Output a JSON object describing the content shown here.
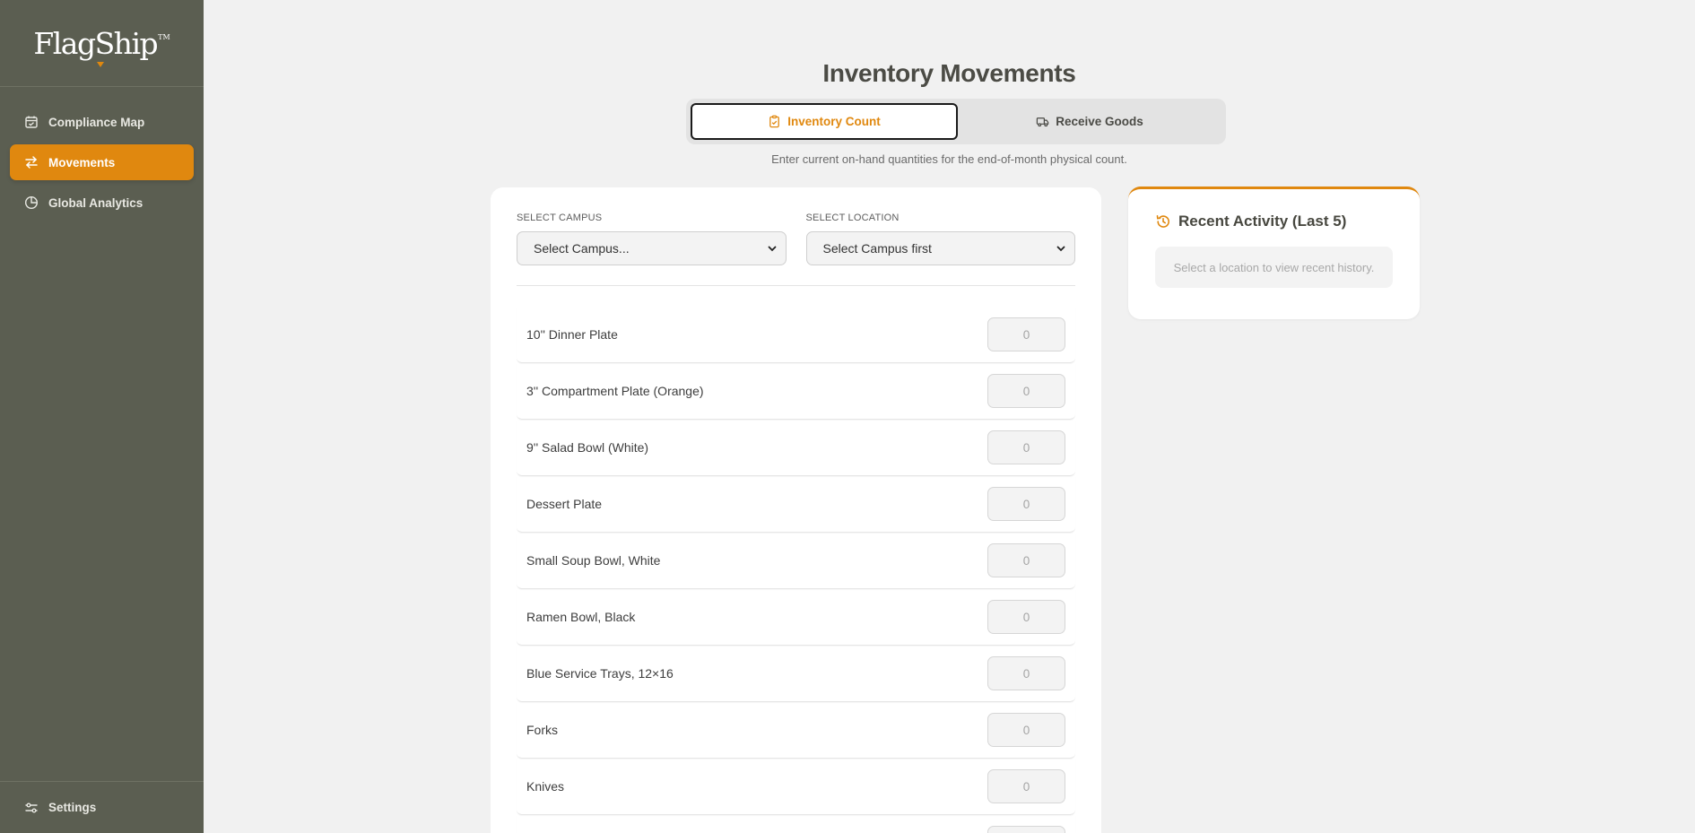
{
  "brand": {
    "name": "FlagShip",
    "tm": "TM",
    "accent": "#e0880f",
    "sidebar_bg": "#5b5e51"
  },
  "sidebar": {
    "items": [
      {
        "label": "Compliance Map",
        "icon": "calendar-check-icon"
      },
      {
        "label": "Movements",
        "icon": "arrows-swap-icon",
        "active": true
      },
      {
        "label": "Global Analytics",
        "icon": "pie-chart-icon"
      }
    ],
    "settings": {
      "label": "Settings",
      "icon": "sliders-icon"
    }
  },
  "header": {
    "title": "Inventory Movements",
    "subtitle": "Enter current on-hand quantities for the end-of-month physical count."
  },
  "tabs": [
    {
      "label": "Inventory Count",
      "icon": "clipboard-check-icon",
      "active": true
    },
    {
      "label": "Receive Goods",
      "icon": "truck-icon"
    }
  ],
  "form": {
    "campus": {
      "label": "SELECT CAMPUS",
      "value": "Select Campus..."
    },
    "location": {
      "label": "SELECT LOCATION",
      "value": "Select Campus first"
    },
    "qty_placeholder": "0",
    "items": [
      "10'' Dinner Plate",
      "3'' Compartment Plate (Orange)",
      "9'' Salad Bowl (White)",
      "Dessert Plate",
      "Small Soup Bowl, White",
      "Ramen Bowl, Black",
      "Blue Service Trays, 12×16",
      "Forks",
      "Knives"
    ]
  },
  "recent": {
    "title": "Recent Activity (Last 5)",
    "icon": "history-icon",
    "empty": "Select a location to view recent history."
  }
}
